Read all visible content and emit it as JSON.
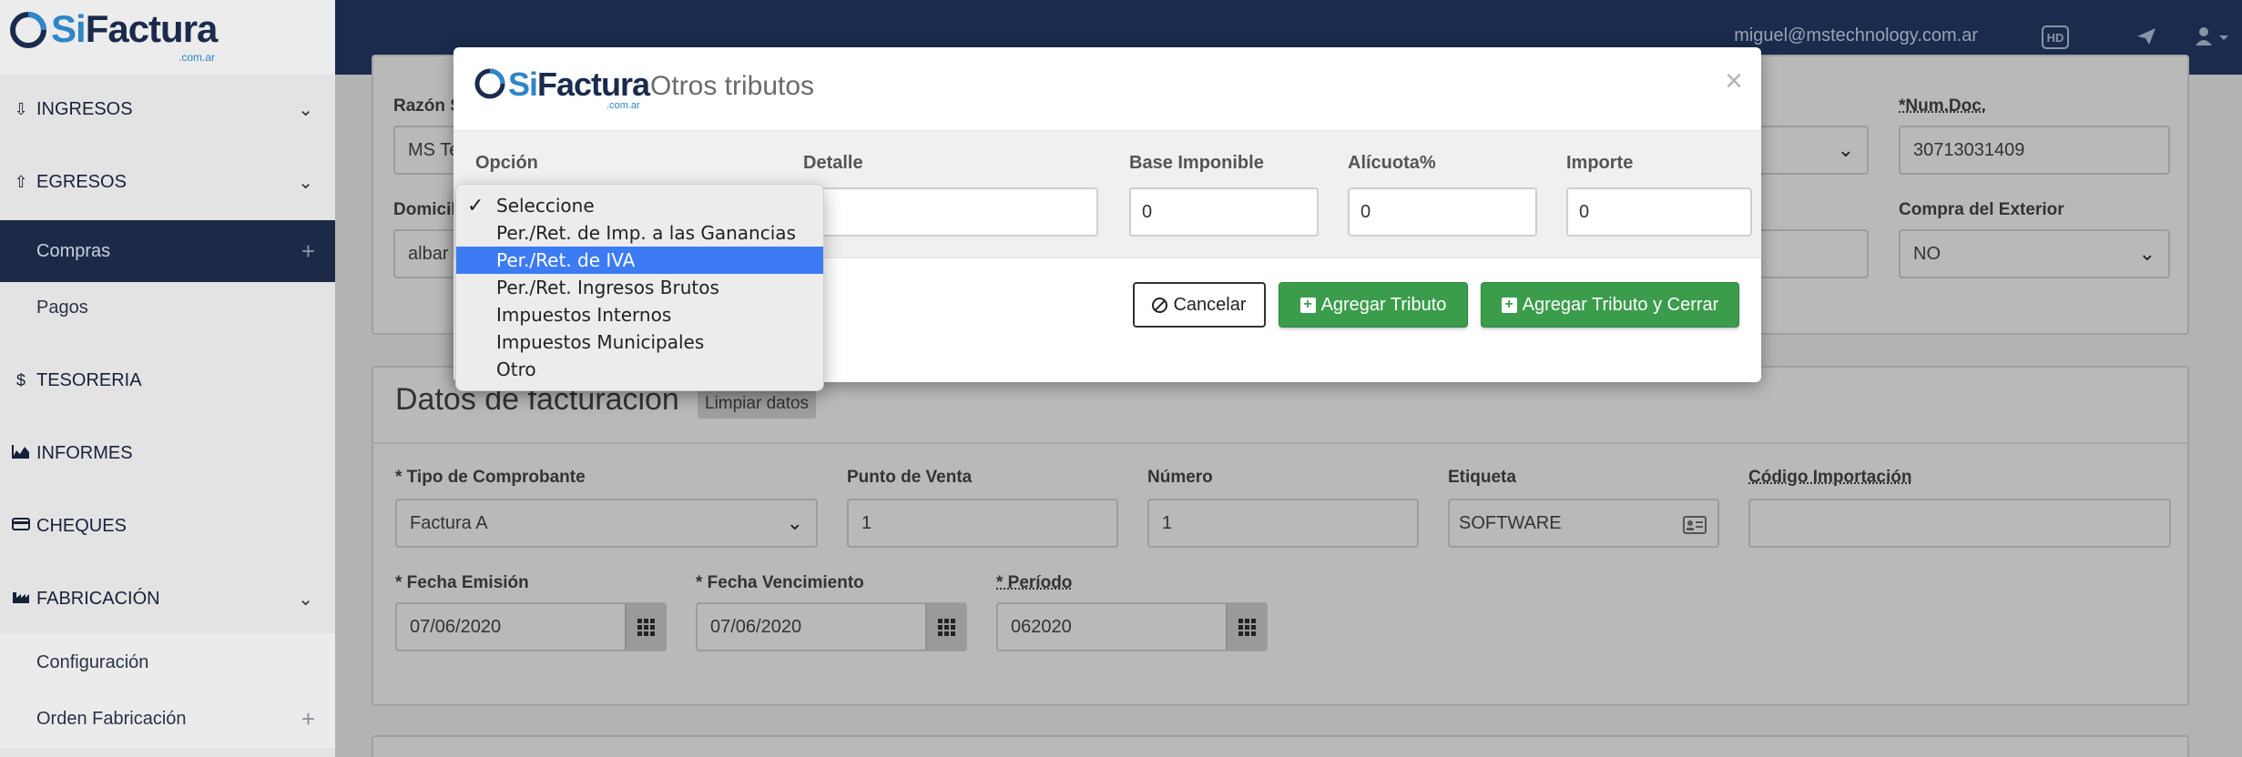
{
  "brand": {
    "name_si": "Si",
    "name_factura": "Factura",
    "tld": ".com.ar",
    "accent": "#2f86c8",
    "navy": "#1a2b4d"
  },
  "topbar": {
    "user_email": "miguel@mstechnology.com.ar",
    "hd_label": "HD"
  },
  "sidebar": {
    "items": [
      {
        "label": "INGRESOS",
        "icon": "upload-icon"
      },
      {
        "label": "EGRESOS",
        "icon": "upload-icon"
      },
      {
        "label": "Compras"
      },
      {
        "label": "Pagos"
      },
      {
        "label": "TESORERIA",
        "icon": "dollar-icon"
      },
      {
        "label": "INFORMES",
        "icon": "area-chart-icon"
      },
      {
        "label": "CHEQUES",
        "icon": "credit-card-icon"
      },
      {
        "label": "FABRICACIÓN",
        "icon": "industry-icon"
      },
      {
        "label": "Configuración"
      },
      {
        "label": "Orden Fabricación"
      }
    ]
  },
  "supplier": {
    "razon_label": "Razón S",
    "razon_value": "MS Te",
    "numdoc_label": "*Num.Doc.",
    "numdoc_value": "30713031409",
    "domicilio_label": "Domicil",
    "domicilio_value": "albar",
    "compra_exterior_label": "Compra del Exterior",
    "compra_exterior_value": "NO"
  },
  "billing": {
    "title": "Datos de facturación",
    "clear_button": "Limpiar datos",
    "tipo_label": "* Tipo de Comprobante",
    "tipo_value": "Factura A",
    "punto_label": "Punto de Venta",
    "punto_value": "1",
    "numero_label": "Número",
    "numero_value": "1",
    "etiqueta_label": "Etiqueta",
    "etiqueta_value": "SOFTWARE",
    "codigo_label": "Código Importación",
    "codigo_value": "",
    "emision_label": "* Fecha Emisión",
    "emision_value": "07/06/2020",
    "vencimiento_label": "* Fecha Vencimiento",
    "vencimiento_value": "07/06/2020",
    "periodo_label": "* Período",
    "periodo_value": "062020"
  },
  "modal": {
    "title": "Otros tributos",
    "close": "×",
    "opcion_label": "Opción",
    "detalle_label": "Detalle",
    "base_label": "Base Imponible",
    "base_value": "0",
    "alicuota_label": "Alícuota%",
    "alicuota_value": "0",
    "importe_label": "Importe",
    "importe_value": "0",
    "cancel_label": "Cancelar",
    "add_label": "Agregar Tributo",
    "add_close_label": "Agregar Tributo y Cerrar"
  },
  "dropdown": {
    "options": [
      "Seleccione",
      "Per./Ret. de Imp. a las Ganancias",
      "Per./Ret. de IVA",
      "Per./Ret. Ingresos Brutos",
      "Impuestos Internos",
      "Impuestos Municipales",
      "Otro"
    ],
    "checked_index": 0,
    "highlighted_index": 2
  }
}
